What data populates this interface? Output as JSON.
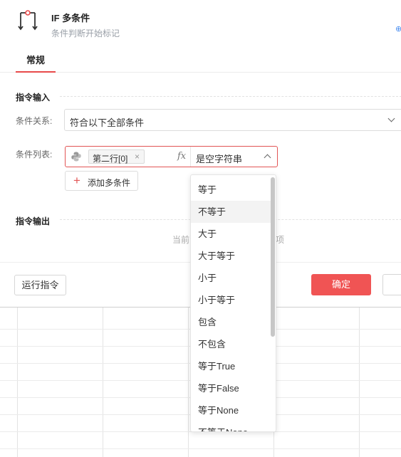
{
  "header": {
    "title": "IF 多条件",
    "subtitle": "条件判断开始标记",
    "icon": "if-branch-icon"
  },
  "tabs": [
    {
      "label": "常规",
      "active": true
    }
  ],
  "input_section": {
    "title": "指令输入",
    "relation_label": "条件关系:",
    "relation_value": "符合以下全部条件",
    "list_label": "条件列表:",
    "condition": {
      "variable": "第二行[0]",
      "variable_icon": "python-icon",
      "fx_label": "fx",
      "operator": "是空字符串"
    },
    "add_button": "添加多条件"
  },
  "output_section": {
    "title": "指令输出",
    "hint_left": "当前",
    "hint_right": "项"
  },
  "footer": {
    "run_button": "运行指令",
    "confirm_button": "确定"
  },
  "dropdown": {
    "hovered_index": 1,
    "options": [
      "等于",
      "不等于",
      "大于",
      "大于等于",
      "小于",
      "小于等于",
      "包含",
      "不包含",
      "等于True",
      "等于False",
      "等于None",
      "不等于None"
    ]
  },
  "colors": {
    "accent": "#f05454",
    "error_border": "#e25555",
    "link_blue": "#4a8ef0"
  }
}
